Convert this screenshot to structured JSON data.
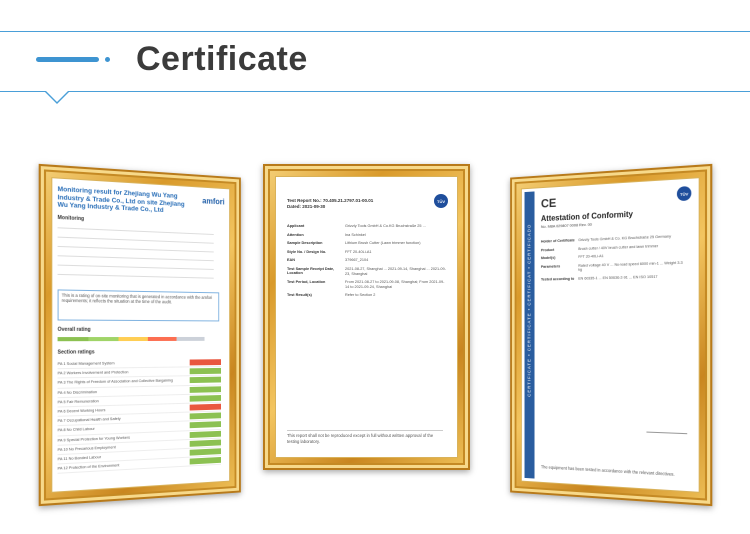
{
  "header": {
    "title": "Certificate",
    "accent_color": "#3e94d1"
  },
  "certificates": [
    {
      "heading": "Monitoring result for Zhejiang Wu Yang Industry & Trade Co., Ltd on site Zhejiang Wu Yang Industry & Trade Co., Ltd",
      "brand": "amfori",
      "section_monitoring": "Monitoring",
      "section_overall": "Overall rating",
      "section_ratings": "Section ratings",
      "note": "This is a rating of on-site monitoring that is generated in accordance with the amfori requirements; it reflects the situation at the time of the audit.",
      "rating_colors": [
        "#8cc152",
        "#a0d468",
        "#ffce54",
        "#fc6e51",
        "#ccd1d9"
      ],
      "sections": [
        {
          "label": "PA 1 Social Management System",
          "color": "#e9573f"
        },
        {
          "label": "PA 2 Workers Involvement and Protection",
          "color": "#8cc152"
        },
        {
          "label": "PA 3 The Rights of Freedom of Association and Collective Bargaining",
          "color": "#8cc152"
        },
        {
          "label": "PA 4 No Discrimination",
          "color": "#8cc152"
        },
        {
          "label": "PA 5 Fair Remuneration",
          "color": "#8cc152"
        },
        {
          "label": "PA 6 Decent Working Hours",
          "color": "#e9573f"
        },
        {
          "label": "PA 7 Occupational Health and Safety",
          "color": "#8cc152"
        },
        {
          "label": "PA 8 No Child Labour",
          "color": "#8cc152"
        },
        {
          "label": "PA 9 Special Protection for Young Workers",
          "color": "#8cc152"
        },
        {
          "label": "PA 10 No Precarious Employment",
          "color": "#8cc152"
        },
        {
          "label": "PA 11 No Bonded Labour",
          "color": "#8cc152"
        },
        {
          "label": "PA 12 Protection of the Environment",
          "color": "#8cc152"
        }
      ]
    },
    {
      "report_no": "Test Report No.: 70.405.21.2797.01-00.01",
      "dated": "Dated: 2021-09-30",
      "rows": [
        {
          "k": "Applicant",
          "v": "Grizzly Tools GmbH & Co.KG Bruchstraße 25 ..."
        },
        {
          "k": "Attention",
          "v": "Ina Schinkel"
        },
        {
          "k": "Sample Description",
          "v": "Lithium Brush Cutter (Lawn trimmer function)"
        },
        {
          "k": "Style No. / Design No.",
          "v": "FFT 20-40Li-A1"
        },
        {
          "k": "EAN",
          "v": "379667_2104"
        },
        {
          "k": "Test Sample Receipt Date, Location",
          "v": "2021-08-27, Shanghai ... 2021-09-14, Shanghai ... 2021-09-23, Shanghai"
        },
        {
          "k": "Test Period, Location",
          "v": "From 2021-08-27 to 2021-09-08, Shanghai; From 2021-09-14 to 2021-09-24, Shanghai"
        },
        {
          "k": "Test Result(s)",
          "v": "Refer to Section 2"
        }
      ],
      "footer": "This report shall not be reproduced except in full without written approval of the testing laboratory."
    },
    {
      "ce_mark": "CE",
      "title": "Attestation of Conformity",
      "number": "No. M8A 029807 0008 Rev. 00",
      "side_text": "CERTIFICATE • CERTIFICATE • CERTIFICAT • CERTIFICADO",
      "rows": [
        {
          "k": "Holder of Certificate",
          "v": "Grizzly Tools GmbH & Co. KG Bruchstraße 25 Germany"
        },
        {
          "k": "Product",
          "v": "Brush cutter / 40V brush cutter and lawn trimmer"
        },
        {
          "k": "Model(s)",
          "v": "FFT 20-40Li-A1"
        },
        {
          "k": "Parameters",
          "v": "Rated voltage 40 V ... No-load speed 6000 min-1 ... Weight 3.3 kg"
        },
        {
          "k": "Tested according to",
          "v": "EN 60335-1 ... EN 50636-2-91 ... EN ISO 10517"
        }
      ],
      "footer": "The equipment has been tested in accordance with the relevant directives."
    }
  ]
}
